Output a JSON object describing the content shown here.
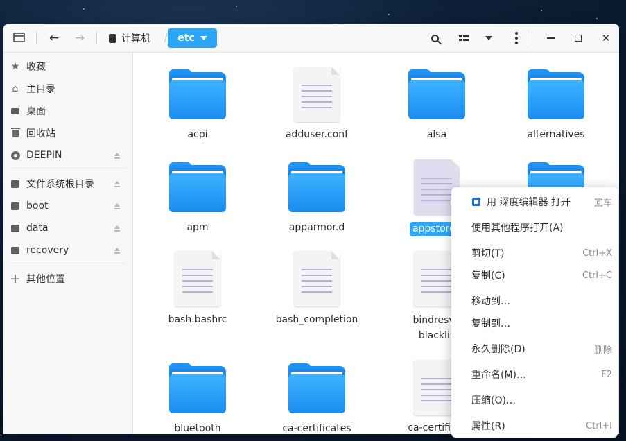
{
  "titlebar": {
    "breadcrumb_home": "计算机",
    "breadcrumb_current": "etc"
  },
  "sidebar": {
    "items": [
      {
        "label": "收藏",
        "icon": "star-icon"
      },
      {
        "label": "主目录",
        "icon": "home-icon"
      },
      {
        "label": "桌面",
        "icon": "desktop-icon"
      },
      {
        "label": "回收站",
        "icon": "trash-icon"
      },
      {
        "label": "DEEPIN",
        "icon": "disc-icon"
      },
      {
        "label": "文件系统根目录",
        "icon": "disk-icon"
      },
      {
        "label": "boot",
        "icon": "disk-icon"
      },
      {
        "label": "data",
        "icon": "disk-icon"
      },
      {
        "label": "recovery",
        "icon": "disk-icon"
      },
      {
        "label": "其他位置",
        "icon": "plus-icon"
      }
    ]
  },
  "files": [
    {
      "name": "acpi",
      "type": "folder"
    },
    {
      "name": "adduser.conf",
      "type": "document"
    },
    {
      "name": "alsa",
      "type": "folder"
    },
    {
      "name": "alternatives",
      "type": "folder"
    },
    {
      "name": "apm",
      "type": "folder"
    },
    {
      "name": "apparmor.d",
      "type": "folder"
    },
    {
      "name": "appstore.j",
      "type": "document",
      "selected": true
    },
    {
      "name": "",
      "type": "folder"
    },
    {
      "name": "bash.bashrc",
      "type": "document"
    },
    {
      "name": "bash_completion",
      "type": "document"
    },
    {
      "name": "bindresvp",
      "name2": "blacklis",
      "type": "document"
    },
    {
      "name": "bluetooth",
      "type": "folder"
    },
    {
      "name": "ca-certificates",
      "type": "folder"
    },
    {
      "name": "ca-certificat",
      "type": "document"
    }
  ],
  "context_menu": {
    "items": [
      {
        "label": "用 深度编辑器 打开",
        "shortcut": "回车"
      },
      {
        "label": "使用其他程序打开(A)",
        "shortcut": ""
      },
      {
        "label": "剪切(T)",
        "shortcut": "Ctrl+X"
      },
      {
        "label": "复制(C)",
        "shortcut": "Ctrl+C"
      },
      {
        "label": "移动到…",
        "shortcut": ""
      },
      {
        "label": "复制到…",
        "shortcut": ""
      },
      {
        "label": "永久删除(D)",
        "shortcut": "删除"
      },
      {
        "label": "重命名(M)…",
        "shortcut": "F2"
      },
      {
        "label": "压缩(O)…",
        "shortcut": ""
      },
      {
        "label": "属性(R)",
        "shortcut": "Ctrl+I"
      }
    ]
  },
  "colors": {
    "accent": "#2ca7f8",
    "folder": "#1a8cf0"
  }
}
